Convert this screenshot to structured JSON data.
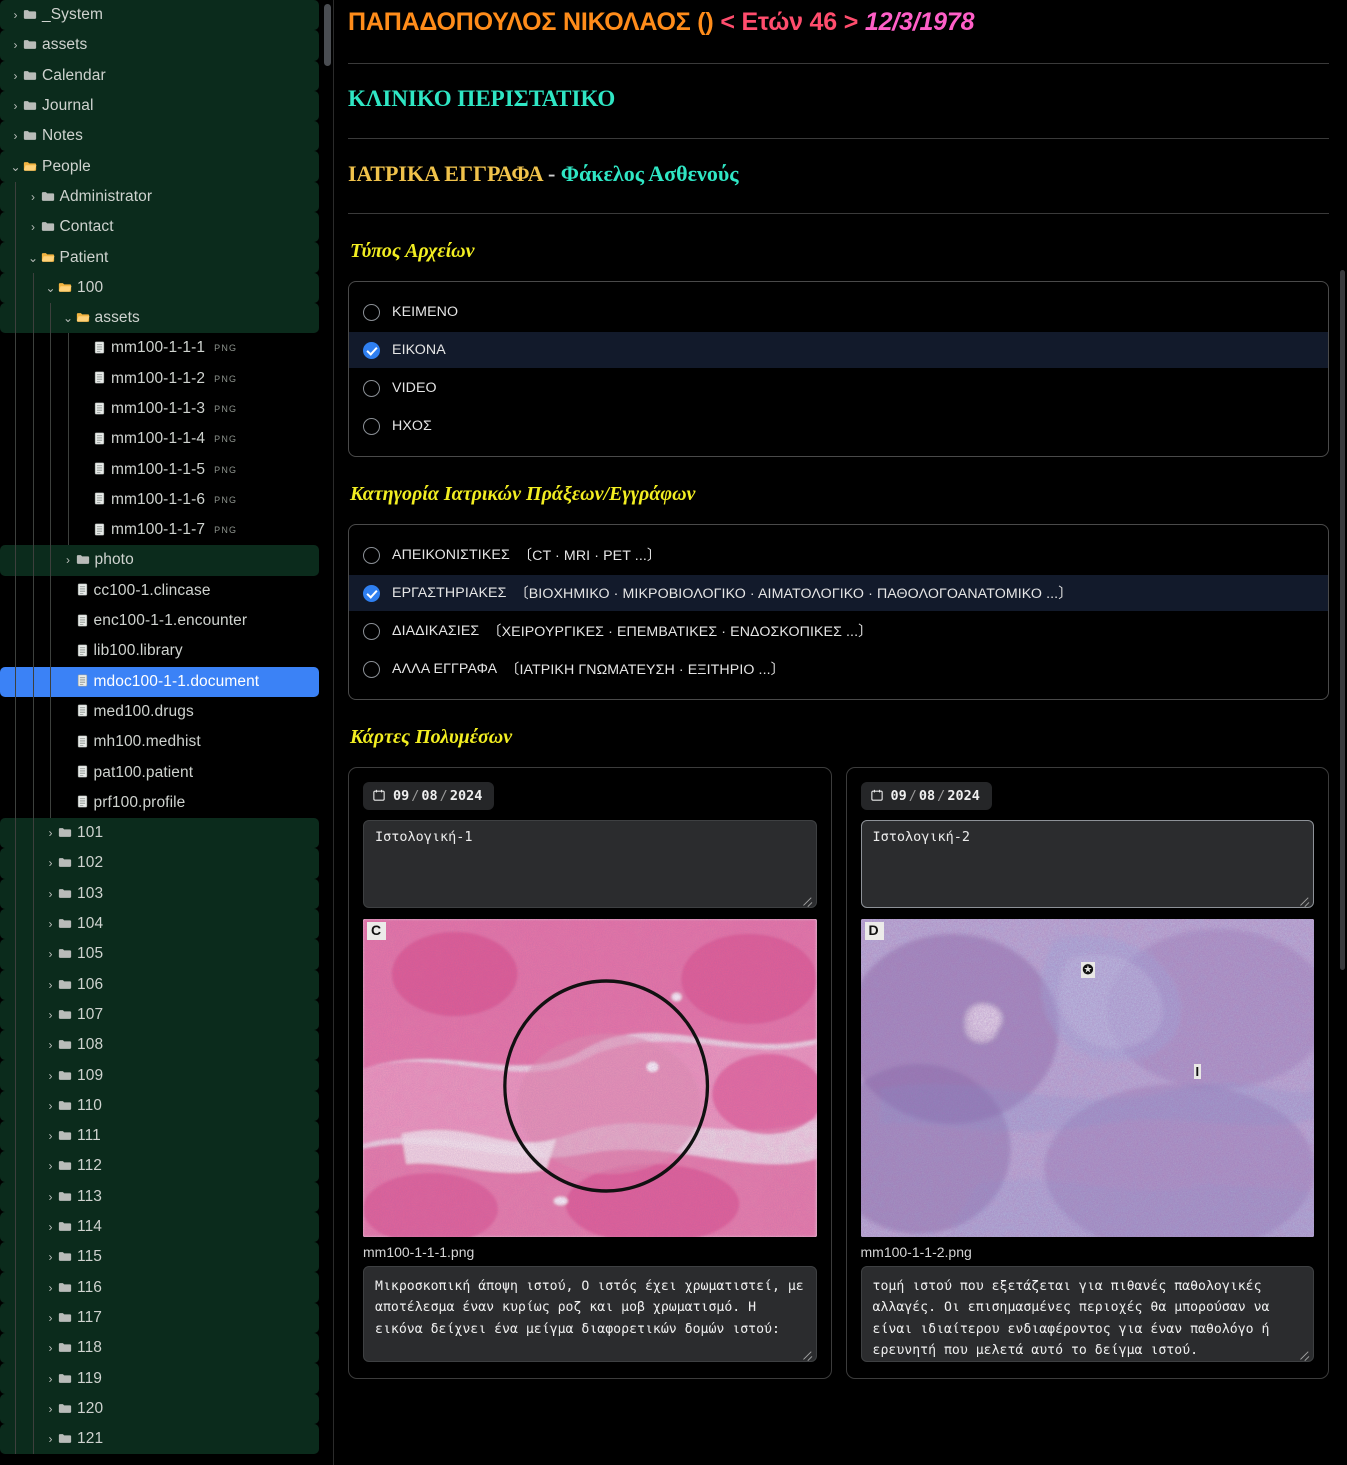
{
  "sidebar": {
    "scrollbar": {
      "name": "sidebar-scrollbar"
    },
    "items": [
      {
        "label": "_System",
        "depth": 0,
        "type": "folder",
        "state": "collapsed",
        "ext": ""
      },
      {
        "label": "assets",
        "depth": 0,
        "type": "folder",
        "state": "collapsed",
        "ext": ""
      },
      {
        "label": "Calendar",
        "depth": 0,
        "type": "folder",
        "state": "collapsed",
        "ext": ""
      },
      {
        "label": "Journal",
        "depth": 0,
        "type": "folder",
        "state": "collapsed",
        "ext": ""
      },
      {
        "label": "Notes",
        "depth": 0,
        "type": "folder",
        "state": "collapsed",
        "ext": ""
      },
      {
        "label": "People",
        "depth": 0,
        "type": "folder",
        "state": "expanded",
        "ext": ""
      },
      {
        "label": "Administrator",
        "depth": 1,
        "type": "folder",
        "state": "collapsed",
        "ext": ""
      },
      {
        "label": "Contact",
        "depth": 1,
        "type": "folder",
        "state": "collapsed",
        "ext": ""
      },
      {
        "label": "Patient",
        "depth": 1,
        "type": "folder",
        "state": "expanded",
        "ext": ""
      },
      {
        "label": "100",
        "depth": 2,
        "type": "folder",
        "state": "expanded",
        "ext": ""
      },
      {
        "label": "assets",
        "depth": 3,
        "type": "folder",
        "state": "expanded",
        "ext": ""
      },
      {
        "label": "mm100-1-1-1",
        "depth": 4,
        "type": "file",
        "state": "",
        "ext": "PNG"
      },
      {
        "label": "mm100-1-1-2",
        "depth": 4,
        "type": "file",
        "state": "",
        "ext": "PNG"
      },
      {
        "label": "mm100-1-1-3",
        "depth": 4,
        "type": "file",
        "state": "",
        "ext": "PNG"
      },
      {
        "label": "mm100-1-1-4",
        "depth": 4,
        "type": "file",
        "state": "",
        "ext": "PNG"
      },
      {
        "label": "mm100-1-1-5",
        "depth": 4,
        "type": "file",
        "state": "",
        "ext": "PNG"
      },
      {
        "label": "mm100-1-1-6",
        "depth": 4,
        "type": "file",
        "state": "",
        "ext": "PNG"
      },
      {
        "label": "mm100-1-1-7",
        "depth": 4,
        "type": "file",
        "state": "",
        "ext": "PNG"
      },
      {
        "label": "photo",
        "depth": 3,
        "type": "folder",
        "state": "collapsed",
        "ext": ""
      },
      {
        "label": "cc100-1.clincase",
        "depth": 3,
        "type": "file",
        "state": "",
        "ext": ""
      },
      {
        "label": "enc100-1-1.encounter",
        "depth": 3,
        "type": "file",
        "state": "",
        "ext": ""
      },
      {
        "label": "lib100.library",
        "depth": 3,
        "type": "file",
        "state": "",
        "ext": ""
      },
      {
        "label": "mdoc100-1-1.document",
        "depth": 3,
        "type": "file",
        "state": "selected",
        "ext": ""
      },
      {
        "label": "med100.drugs",
        "depth": 3,
        "type": "file",
        "state": "",
        "ext": ""
      },
      {
        "label": "mh100.medhist",
        "depth": 3,
        "type": "file",
        "state": "",
        "ext": ""
      },
      {
        "label": "pat100.patient",
        "depth": 3,
        "type": "file",
        "state": "",
        "ext": ""
      },
      {
        "label": "prf100.profile",
        "depth": 3,
        "type": "file",
        "state": "",
        "ext": ""
      },
      {
        "label": "101",
        "depth": 2,
        "type": "folder",
        "state": "collapsed",
        "ext": ""
      },
      {
        "label": "102",
        "depth": 2,
        "type": "folder",
        "state": "collapsed",
        "ext": ""
      },
      {
        "label": "103",
        "depth": 2,
        "type": "folder",
        "state": "collapsed",
        "ext": ""
      },
      {
        "label": "104",
        "depth": 2,
        "type": "folder",
        "state": "collapsed",
        "ext": ""
      },
      {
        "label": "105",
        "depth": 2,
        "type": "folder",
        "state": "collapsed",
        "ext": ""
      },
      {
        "label": "106",
        "depth": 2,
        "type": "folder",
        "state": "collapsed",
        "ext": ""
      },
      {
        "label": "107",
        "depth": 2,
        "type": "folder",
        "state": "collapsed",
        "ext": ""
      },
      {
        "label": "108",
        "depth": 2,
        "type": "folder",
        "state": "collapsed",
        "ext": ""
      },
      {
        "label": "109",
        "depth": 2,
        "type": "folder",
        "state": "collapsed",
        "ext": ""
      },
      {
        "label": "110",
        "depth": 2,
        "type": "folder",
        "state": "collapsed",
        "ext": ""
      },
      {
        "label": "111",
        "depth": 2,
        "type": "folder",
        "state": "collapsed",
        "ext": ""
      },
      {
        "label": "112",
        "depth": 2,
        "type": "folder",
        "state": "collapsed",
        "ext": ""
      },
      {
        "label": "113",
        "depth": 2,
        "type": "folder",
        "state": "collapsed",
        "ext": ""
      },
      {
        "label": "114",
        "depth": 2,
        "type": "folder",
        "state": "collapsed",
        "ext": ""
      },
      {
        "label": "115",
        "depth": 2,
        "type": "folder",
        "state": "collapsed",
        "ext": ""
      },
      {
        "label": "116",
        "depth": 2,
        "type": "folder",
        "state": "collapsed",
        "ext": ""
      },
      {
        "label": "117",
        "depth": 2,
        "type": "folder",
        "state": "collapsed",
        "ext": ""
      },
      {
        "label": "118",
        "depth": 2,
        "type": "folder",
        "state": "collapsed",
        "ext": ""
      },
      {
        "label": "119",
        "depth": 2,
        "type": "folder",
        "state": "collapsed",
        "ext": ""
      },
      {
        "label": "120",
        "depth": 2,
        "type": "folder",
        "state": "collapsed",
        "ext": ""
      },
      {
        "label": "121",
        "depth": 2,
        "type": "folder",
        "state": "collapsed",
        "ext": ""
      }
    ],
    "icons": {
      "collapsed": "›",
      "expanded": "⌄",
      "folder_closed": "folder-closed-icon",
      "folder_open": "folder-open-icon",
      "file": "file-icon"
    }
  },
  "header": {
    "patient_name": "ΠΑΠΑΔΟΠΟΥΛΟΣ ΝΙΚΟΛΑΟΣ ()",
    "age": "< Ετών 46 >",
    "dob": "12/3/1978"
  },
  "clinical_case_title": "ΚΛΙΝΙΚΟ ΠΕΡΙΣΤΑΤΙΚΟ",
  "documents": {
    "title_a": "ΙΑΤΡΙΚΑ ΕΓΓΡΑΦΑ",
    "dash": " - ",
    "title_b": "Φάκελος Ασθενούς"
  },
  "file_type": {
    "section_title": "Τύπος Αρχείων",
    "options": [
      {
        "label": "ΚΕΙΜΕΝΟ",
        "sub": "",
        "checked": false
      },
      {
        "label": "ΕΙΚΟΝΑ",
        "sub": "",
        "checked": true
      },
      {
        "label": "VIDEO",
        "sub": "",
        "checked": false
      },
      {
        "label": "ΗΧΟΣ",
        "sub": "",
        "checked": false
      }
    ]
  },
  "category": {
    "section_title": "Κατηγορία Ιατρικών Πράξεων/Εγγράφων",
    "options": [
      {
        "label": "ΑΠΕΙΚΟΝΙΣΤΙΚΕΣ",
        "sub": "〔CT · MRI · PET ...〕",
        "checked": false
      },
      {
        "label": "ΕΡΓΑΣΤΗΡΙΑΚΕΣ",
        "sub": "〔ΒΙΟΧΗΜΙΚΟ · ΜΙΚΡΟΒΙΟΛΟΓΙΚΟ · ΑΙΜΑΤΟΛΟΓΙΚΟ · ΠΑΘΟΛΟΓΟΑΝΑΤΟΜΙΚΟ ...〕",
        "checked": true
      },
      {
        "label": "ΔΙΑΔΙΚΑΣΙΕΣ",
        "sub": "〔ΧΕΙΡΟΥΡΓΙΚΕΣ · ΕΠΕΜΒΑΤΙΚΕΣ · ΕΝΔΟΣΚΟΠΙΚΕΣ ...〕",
        "checked": false
      },
      {
        "label": "ΑΛΛΑ ΕΓΓΡΑΦΑ",
        "sub": "〔ΙΑΤΡΙΚΗ ΓΝΩΜΑΤΕΥΣΗ · ΕΞΙΤΗΡΙΟ ...〕",
        "checked": false
      }
    ]
  },
  "multimedia": {
    "section_title": "Κάρτες Πολυμέσων",
    "cards": [
      {
        "date": {
          "month": "09",
          "day": "08",
          "year": "2024",
          "sep": "/"
        },
        "title": "Ιστολογική-1",
        "title_focused": false,
        "panel_letter": "C",
        "filename": "mm100-1-1-1.png",
        "description": "Μικροσκοπική άποψη ιστού, Ο ιστός έχει χρωματιστεί, με αποτέλεσμα έναν κυρίως ροζ και μοβ χρωματισμό. Η εικόνα δείχνει ένα μείγμα διαφορετικών δομών ιστού:"
      },
      {
        "date": {
          "month": "09",
          "day": "08",
          "year": "2024",
          "sep": "/"
        },
        "title": "Ιστολογική-2",
        "title_focused": true,
        "panel_letter": "D",
        "filename": "mm100-1-1-2.png",
        "description": "τομή ιστού που εξετάζεται για πιθανές παθολογικές αλλαγές. Οι επισημασμένες περιοχές θα μπορούσαν να είναι ιδιαίτερου ενδιαφέροντος για έναν παθολόγο ή ερευνητή που μελετά αυτό το δείγμα ιστού."
      }
    ]
  },
  "colors": {
    "background": "#000000",
    "sidebar_folder_row": "#0b2b1c",
    "sidebar_selected": "#3b82f6",
    "accent_orange": "#ff8c1a",
    "accent_pink": "#ff4d6d",
    "accent_magenta": "#ff5fc8",
    "accent_teal": "#2fe6c4",
    "accent_gold": "#f0c24b",
    "accent_yellow": "#f2ee21",
    "radio_checked": "#2f7ff0",
    "radio_row_selected_bg": "#121a2b"
  }
}
